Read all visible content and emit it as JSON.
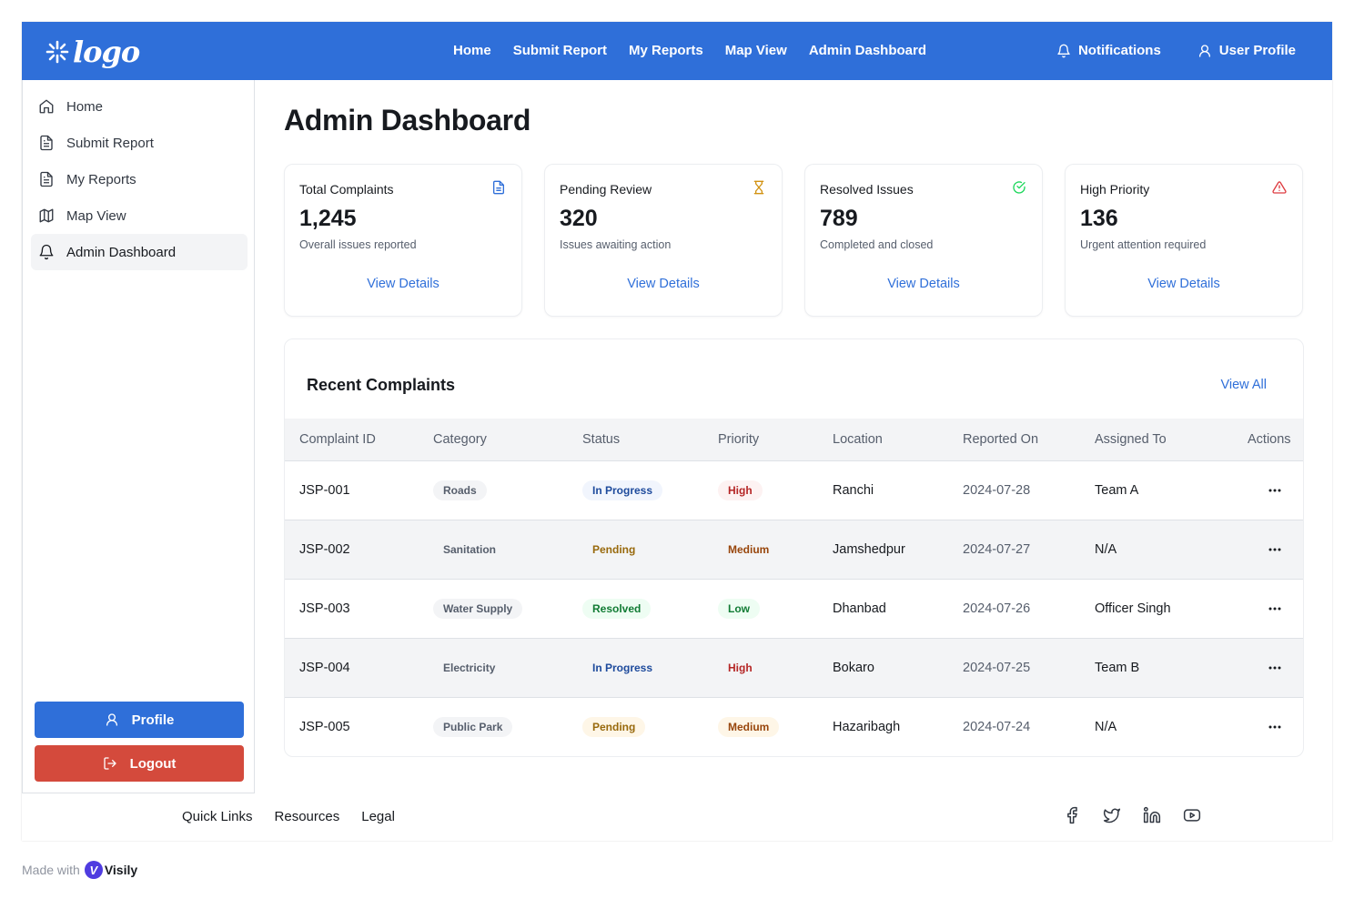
{
  "header": {
    "logo_text": "logo",
    "nav": [
      "Home",
      "Submit Report",
      "My Reports",
      "Map View",
      "Admin Dashboard"
    ],
    "active_nav": "Admin Dashboard",
    "notifications_label": "Notifications",
    "user_profile_label": "User Profile",
    "brand_color": "#2f6fd9"
  },
  "sidebar": {
    "items": [
      {
        "label": "Home",
        "icon": "home-icon"
      },
      {
        "label": "Submit Report",
        "icon": "document-icon"
      },
      {
        "label": "My Reports",
        "icon": "document-icon"
      },
      {
        "label": "Map View",
        "icon": "map-icon"
      },
      {
        "label": "Admin Dashboard",
        "icon": "bell-icon"
      }
    ],
    "active": "Admin Dashboard",
    "profile_button": "Profile",
    "logout_button": "Logout"
  },
  "page": {
    "title": "Admin Dashboard"
  },
  "stats": [
    {
      "title": "Total Complaints",
      "value": "1,245",
      "subtitle": "Overall issues reported",
      "link": "View Details",
      "icon": "document-icon",
      "icon_color": "#2f6fd9"
    },
    {
      "title": "Pending Review",
      "value": "320",
      "subtitle": "Issues awaiting action",
      "link": "View Details",
      "icon": "hourglass-icon",
      "icon_color": "#d29211"
    },
    {
      "title": "Resolved Issues",
      "value": "789",
      "subtitle": "Completed and closed",
      "link": "View Details",
      "icon": "check-circle-icon",
      "icon_color": "#1dd75b"
    },
    {
      "title": "High Priority",
      "value": "136",
      "subtitle": "Urgent attention required",
      "link": "View Details",
      "icon": "alert-triangle-icon",
      "icon_color": "#de3b40"
    }
  ],
  "recent": {
    "title": "Recent Complaints",
    "view_all": "View All",
    "columns": [
      "Complaint ID",
      "Category",
      "Status",
      "Priority",
      "Location",
      "Reported On",
      "Assigned To",
      "Actions"
    ],
    "rows": [
      {
        "id": "JSP-001",
        "category": "Roads",
        "status": "In Progress",
        "priority": "High",
        "location": "Ranchi",
        "reported": "2024-07-28",
        "assigned": "Team A"
      },
      {
        "id": "JSP-002",
        "category": "Sanitation",
        "status": "Pending",
        "priority": "Medium",
        "location": "Jamshedpur",
        "reported": "2024-07-27",
        "assigned": "N/A"
      },
      {
        "id": "JSP-003",
        "category": "Water Supply",
        "status": "Resolved",
        "priority": "Low",
        "location": "Dhanbad",
        "reported": "2024-07-26",
        "assigned": "Officer Singh"
      },
      {
        "id": "JSP-004",
        "category": "Electricity",
        "status": "In Progress",
        "priority": "High",
        "location": "Bokaro",
        "reported": "2024-07-25",
        "assigned": "Team B"
      },
      {
        "id": "JSP-005",
        "category": "Public Park",
        "status": "Pending",
        "priority": "Medium",
        "location": "Hazaribagh",
        "reported": "2024-07-24",
        "assigned": "N/A"
      }
    ]
  },
  "footer": {
    "links": [
      "Quick Links",
      "Resources",
      "Legal"
    ],
    "socials": [
      "facebook-icon",
      "twitter-icon",
      "linkedin-icon",
      "youtube-icon"
    ]
  },
  "made_with": {
    "prefix": "Made with",
    "brand": "Visily"
  }
}
